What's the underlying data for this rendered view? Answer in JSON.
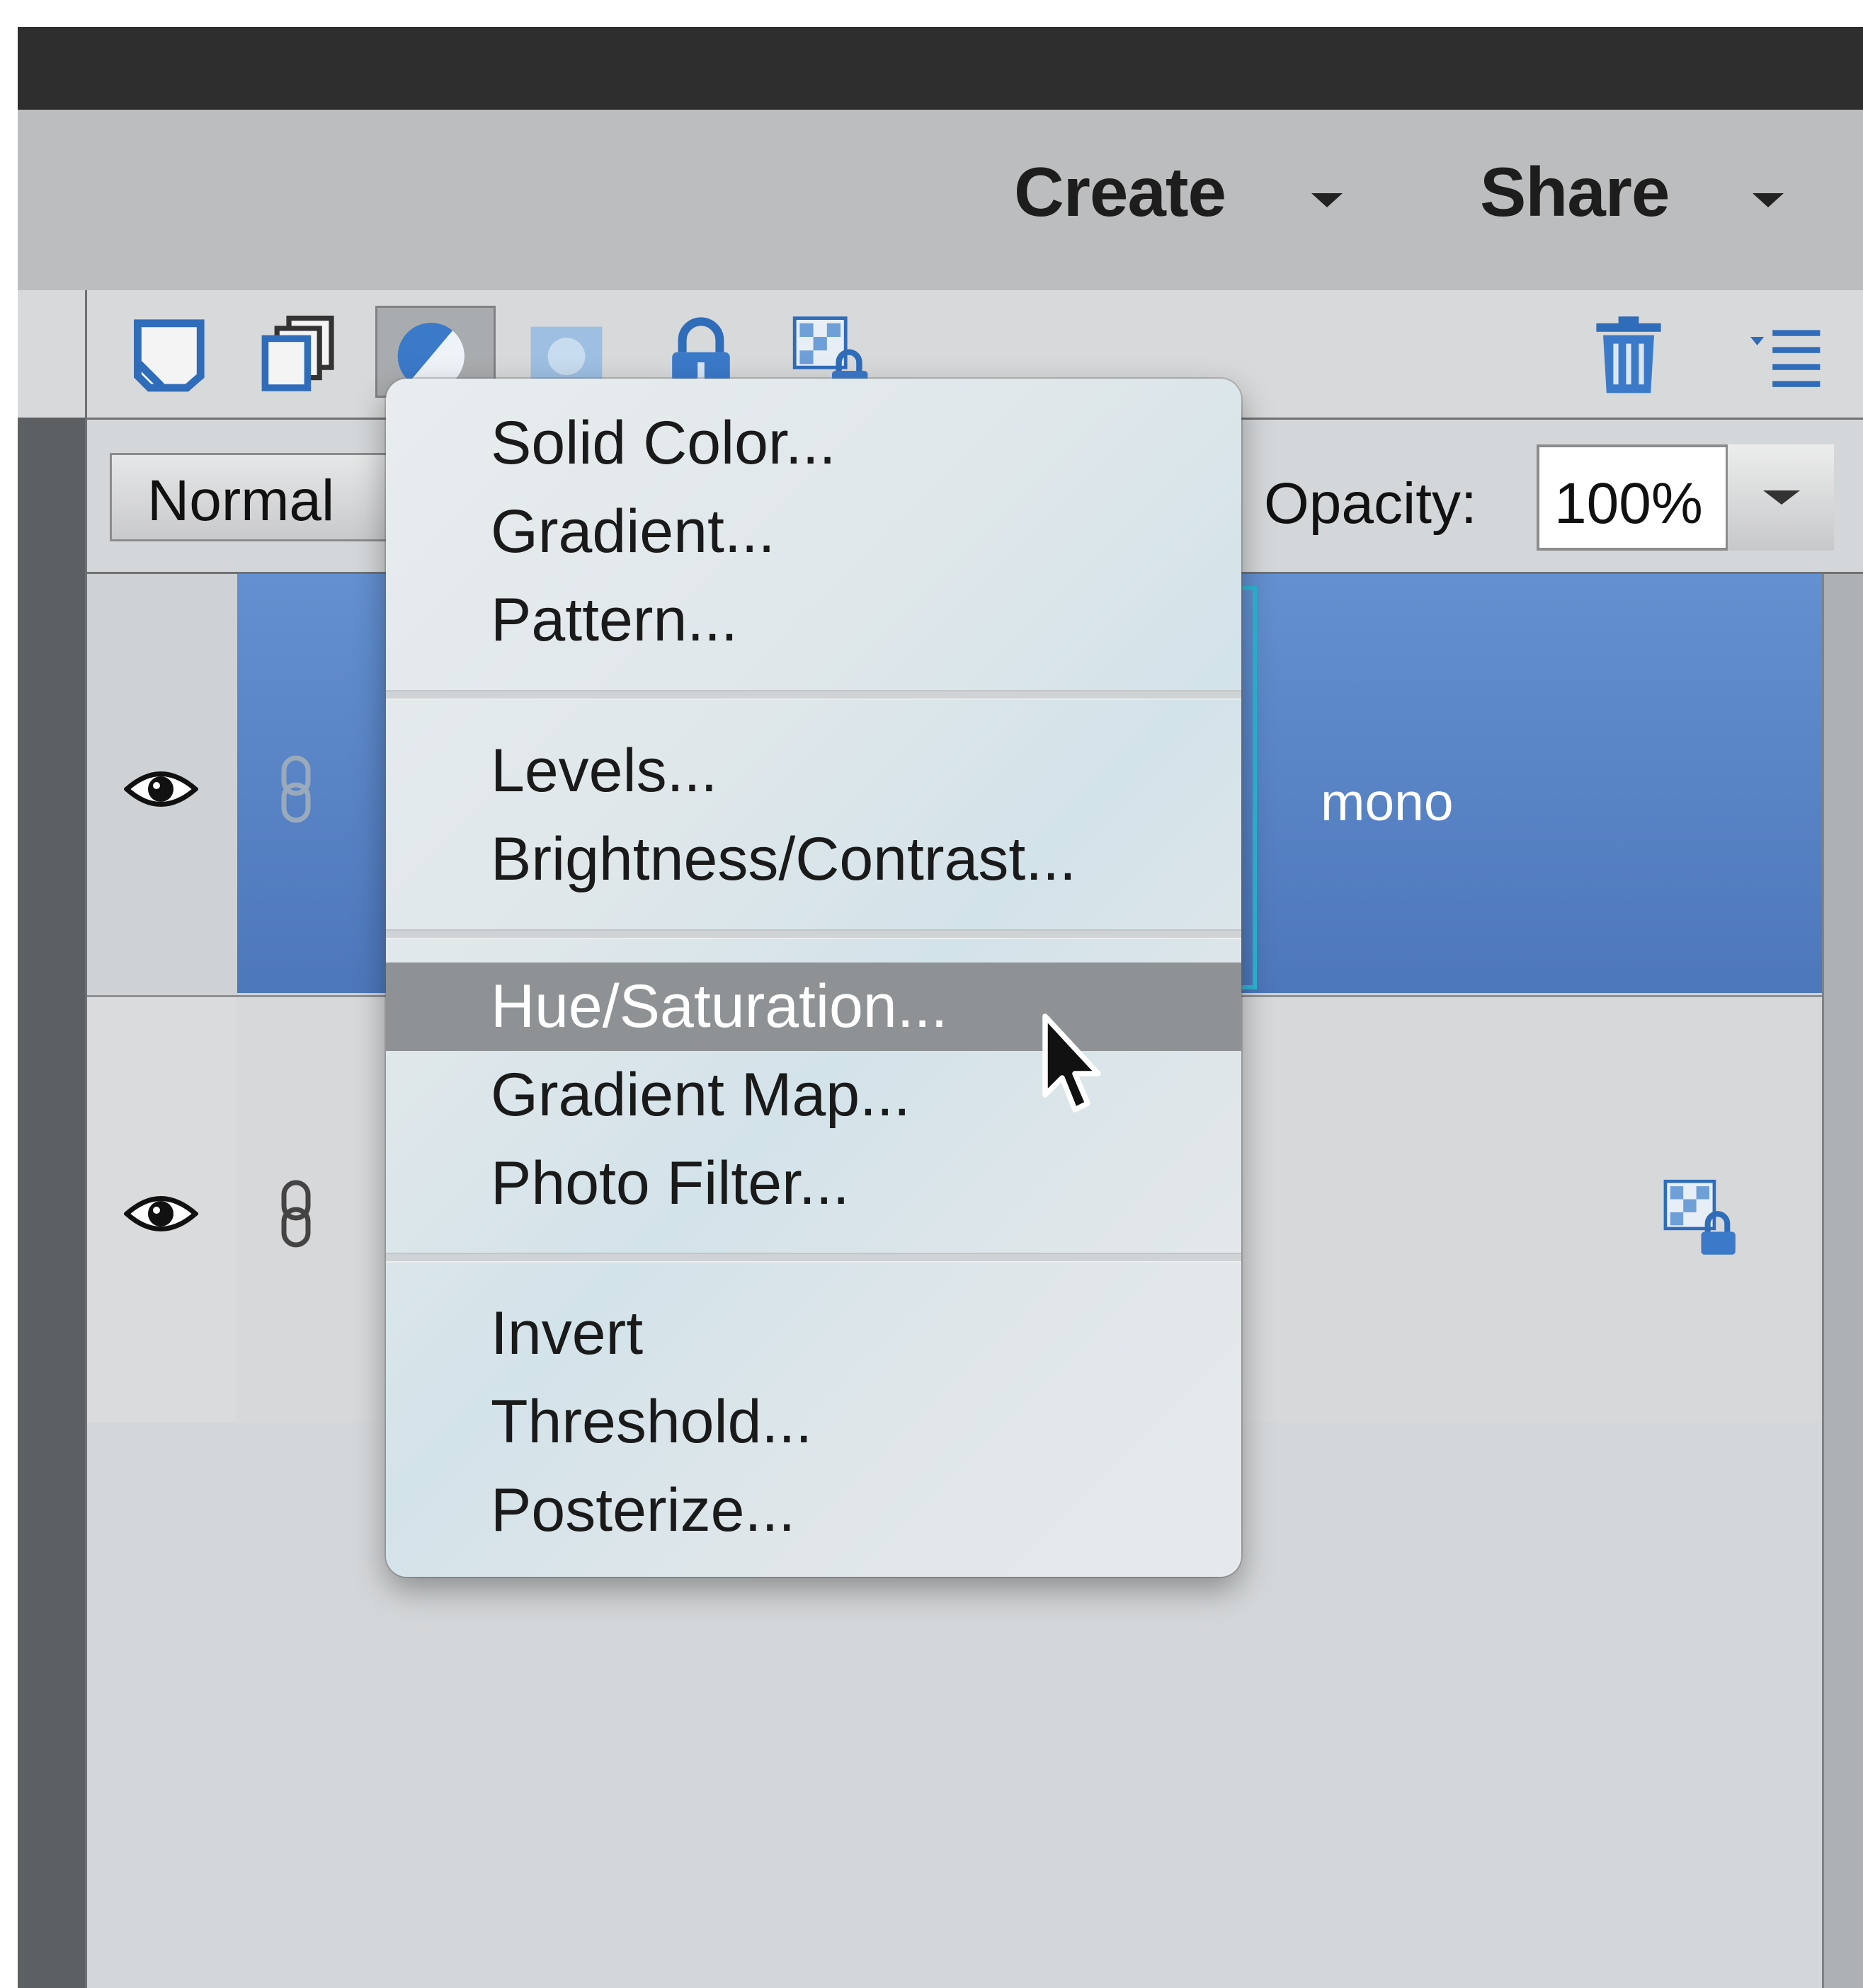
{
  "menubar": {
    "create_label": "Create",
    "share_label": "Share"
  },
  "layers_panel": {
    "blend_mode": "Normal",
    "opacity_label": "Opacity:",
    "opacity_value": "100%",
    "layers": [
      {
        "name": "mono",
        "selected": true
      },
      {
        "name": "",
        "selected": false
      }
    ]
  },
  "adjustment_menu": {
    "groups": [
      [
        "Solid Color...",
        "Gradient...",
        "Pattern..."
      ],
      [
        "Levels...",
        "Brightness/Contrast..."
      ],
      [
        "Hue/Saturation...",
        "Gradient Map...",
        "Photo Filter..."
      ],
      [
        "Invert",
        "Threshold...",
        "Posterize..."
      ]
    ],
    "highlighted": "Hue/Saturation..."
  },
  "colors": {
    "selection_blue": "#5a85c8",
    "menu_highlight": "#8f9294",
    "accent_icon": "#3b79c9"
  },
  "icons": [
    "new-layer-icon",
    "duplicate-layer-icon",
    "adjustment-layer-icon",
    "layer-mask-icon",
    "lock-all-icon",
    "lock-transparency-icon",
    "trash-icon",
    "panel-menu-icon",
    "eye-icon",
    "link-icon",
    "mouse-cursor-icon"
  ]
}
